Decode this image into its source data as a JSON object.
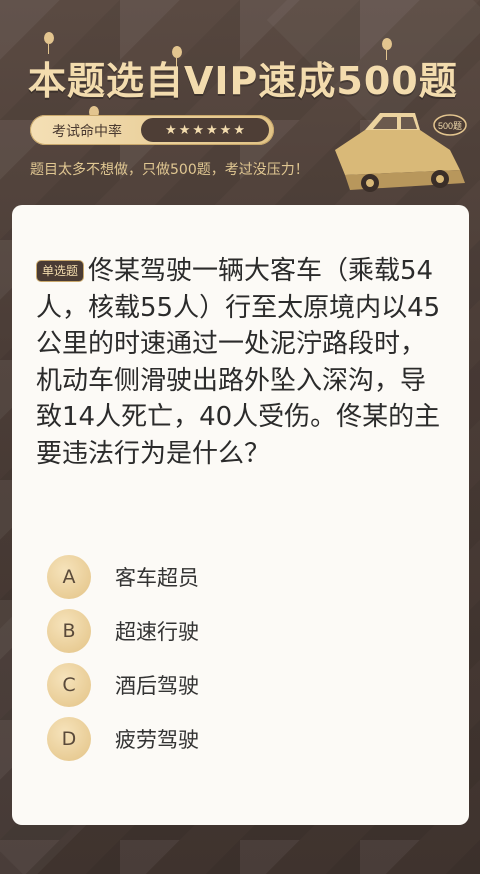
{
  "banner": {
    "title": "本题选自VIP速成500题",
    "hit_rate_label": "考试命中率",
    "stars": [
      "★",
      "★",
      "★",
      "★",
      "★",
      "★"
    ],
    "subtitle": "题目太多不想做，只做500题，考过没压力！",
    "car_badge": "500题"
  },
  "question": {
    "type_tag": "单选题",
    "text": "佟某驾驶一辆大客车（乘载54人，核载55人）行至太原境内以45公里的时速通过一处泥泞路段时，机动车侧滑驶出路外坠入深沟，导致14人死亡，40人受伤。佟某的主要违法行为是什么？"
  },
  "options": [
    {
      "letter": "A",
      "text": "客车超员"
    },
    {
      "letter": "B",
      "text": "超速行驶"
    },
    {
      "letter": "C",
      "text": "酒后驾驶"
    },
    {
      "letter": "D",
      "text": "疲劳驾驶"
    }
  ],
  "colors": {
    "background": "#4a3c36",
    "gold": "#f3dcae",
    "card": "#fcfaf6"
  }
}
